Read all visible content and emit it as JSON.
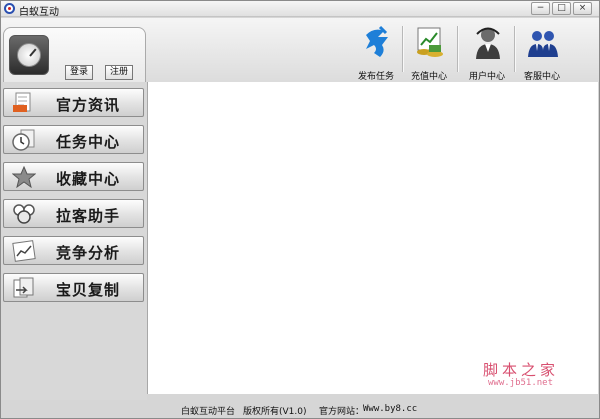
{
  "window": {
    "title": "白蚁互动",
    "min_label": "−",
    "max_label": "□",
    "close_label": "×"
  },
  "account": {
    "login_label": "登录",
    "register_label": "注册"
  },
  "toolbar": {
    "items": [
      {
        "label": "发布任务",
        "icon": "publish-icon"
      },
      {
        "label": "充值中心",
        "icon": "recharge-icon"
      },
      {
        "label": "用户中心",
        "icon": "user-icon"
      },
      {
        "label": "客服中心",
        "icon": "service-icon"
      }
    ]
  },
  "sidebar": {
    "items": [
      {
        "label": "官方资讯",
        "icon": "news-icon"
      },
      {
        "label": "任务中心",
        "icon": "clock-icon"
      },
      {
        "label": "收藏中心",
        "icon": "star-icon"
      },
      {
        "label": "拉客助手",
        "icon": "people-icon"
      },
      {
        "label": "竞争分析",
        "icon": "chart-icon"
      },
      {
        "label": "宝贝复制",
        "icon": "copy-icon"
      }
    ]
  },
  "watermark": {
    "site_name": "脚本之家",
    "url": "www.jb51.net"
  },
  "statusbar": {
    "platform": "白蚁互动平台",
    "copyright": "版权所有(V1.0)",
    "site_label": "官方网站：",
    "site_url": "Www.by8.cc"
  },
  "colors": {
    "accent_blue": "#1e7fd8",
    "watermark": "#d85070"
  }
}
